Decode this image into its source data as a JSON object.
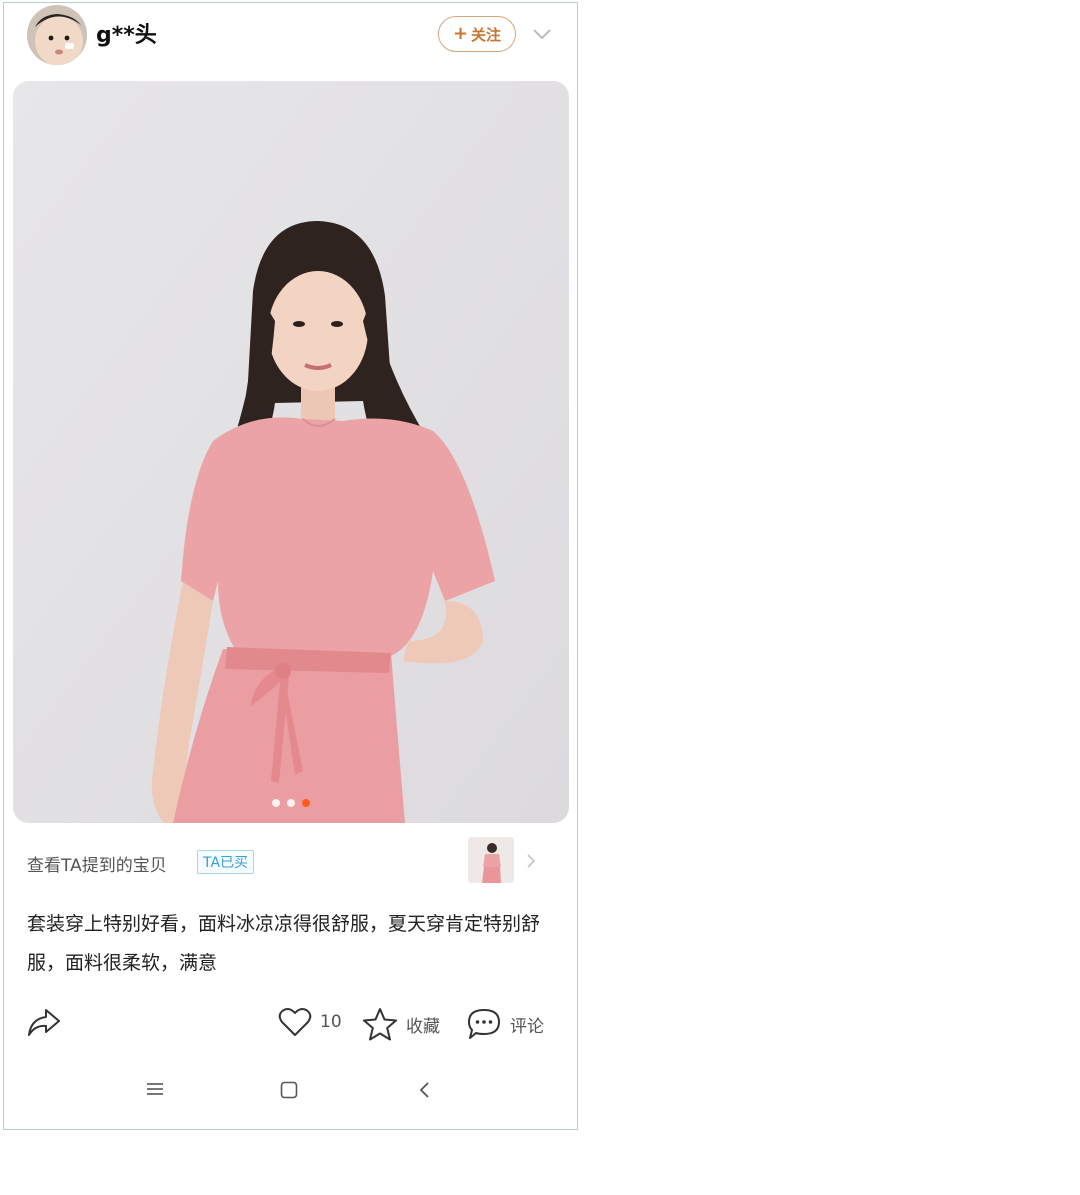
{
  "header": {
    "username": "g**头",
    "follow_label": "关注",
    "follow_symbol": "+"
  },
  "photo": {
    "page_count": 3,
    "active_page": 3
  },
  "mention": {
    "text": "查看TA提到的宝贝",
    "badge": "TA已买"
  },
  "review": {
    "text": "套装穿上特别好看，面料冰凉凉得很舒服，夏天穿肯定特别舒服，面料很柔软，满意"
  },
  "actions": {
    "like_count": "10",
    "favorite_label": "收藏",
    "comment_label": "评论"
  },
  "icons": {
    "share": "share-icon",
    "like": "heart-icon",
    "favorite": "star-icon",
    "comment": "comment-icon",
    "menu": "menu-icon",
    "home": "home-icon",
    "back": "back-icon"
  },
  "colors": {
    "accent": "#ff5a1f",
    "follow": "#c8742f",
    "badge": "#3a9fd1",
    "dress": "#eba3a6"
  }
}
